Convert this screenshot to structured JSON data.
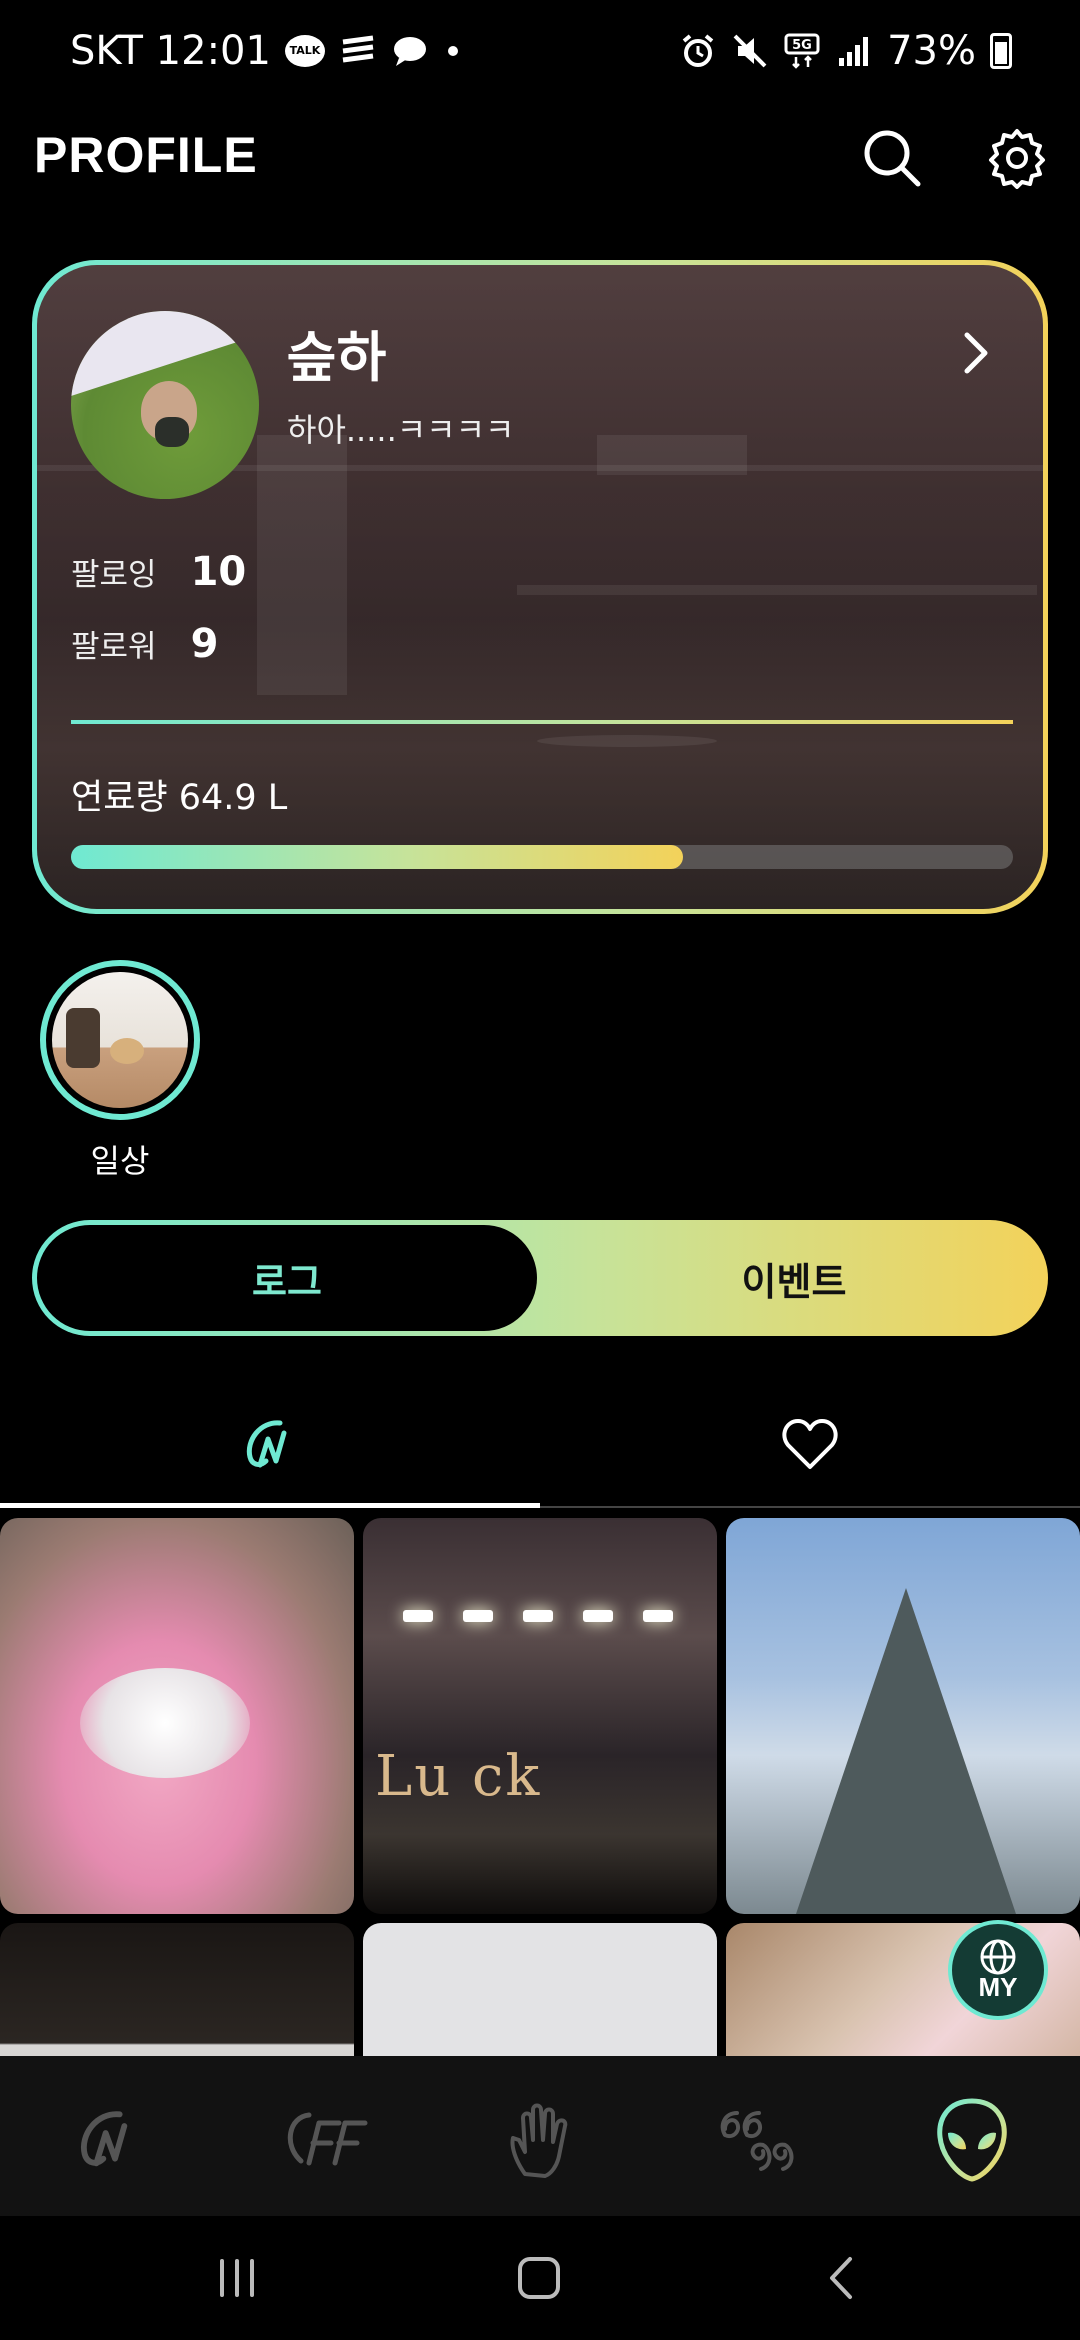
{
  "status_bar": {
    "carrier_time": "SKT 12:01",
    "talk_badge": "TALK",
    "network": "5G",
    "battery": "73%"
  },
  "header": {
    "title": "PROFILE"
  },
  "profile": {
    "name": "슾하",
    "bio": "하아.....ㅋㅋㅋㅋ",
    "following_label": "팔로잉",
    "following_count": "10",
    "followers_label": "팔로워",
    "followers_count": "9",
    "fuel_label": "연료량 64.9 L",
    "fuel_progress": 0.65
  },
  "highlights": [
    {
      "label": "일상"
    }
  ],
  "segment": {
    "left_label": "로그",
    "right_label": "이벤트",
    "selected": "left"
  },
  "subtabs": {
    "selected": 0,
    "items": [
      "logo-n-icon",
      "heart-icon"
    ]
  },
  "grid": {
    "stage_text": "Lu   ck",
    "fab_label": "MY"
  },
  "bottom_nav": {
    "items": [
      "logo-n-icon",
      "ff-icon",
      "hand-icon",
      "quote-icon",
      "alien-icon"
    ],
    "selected": 4
  },
  "colors": {
    "mint": "#6fe9d2",
    "lime": "#c6e39a",
    "yellow": "#f3d25a"
  }
}
